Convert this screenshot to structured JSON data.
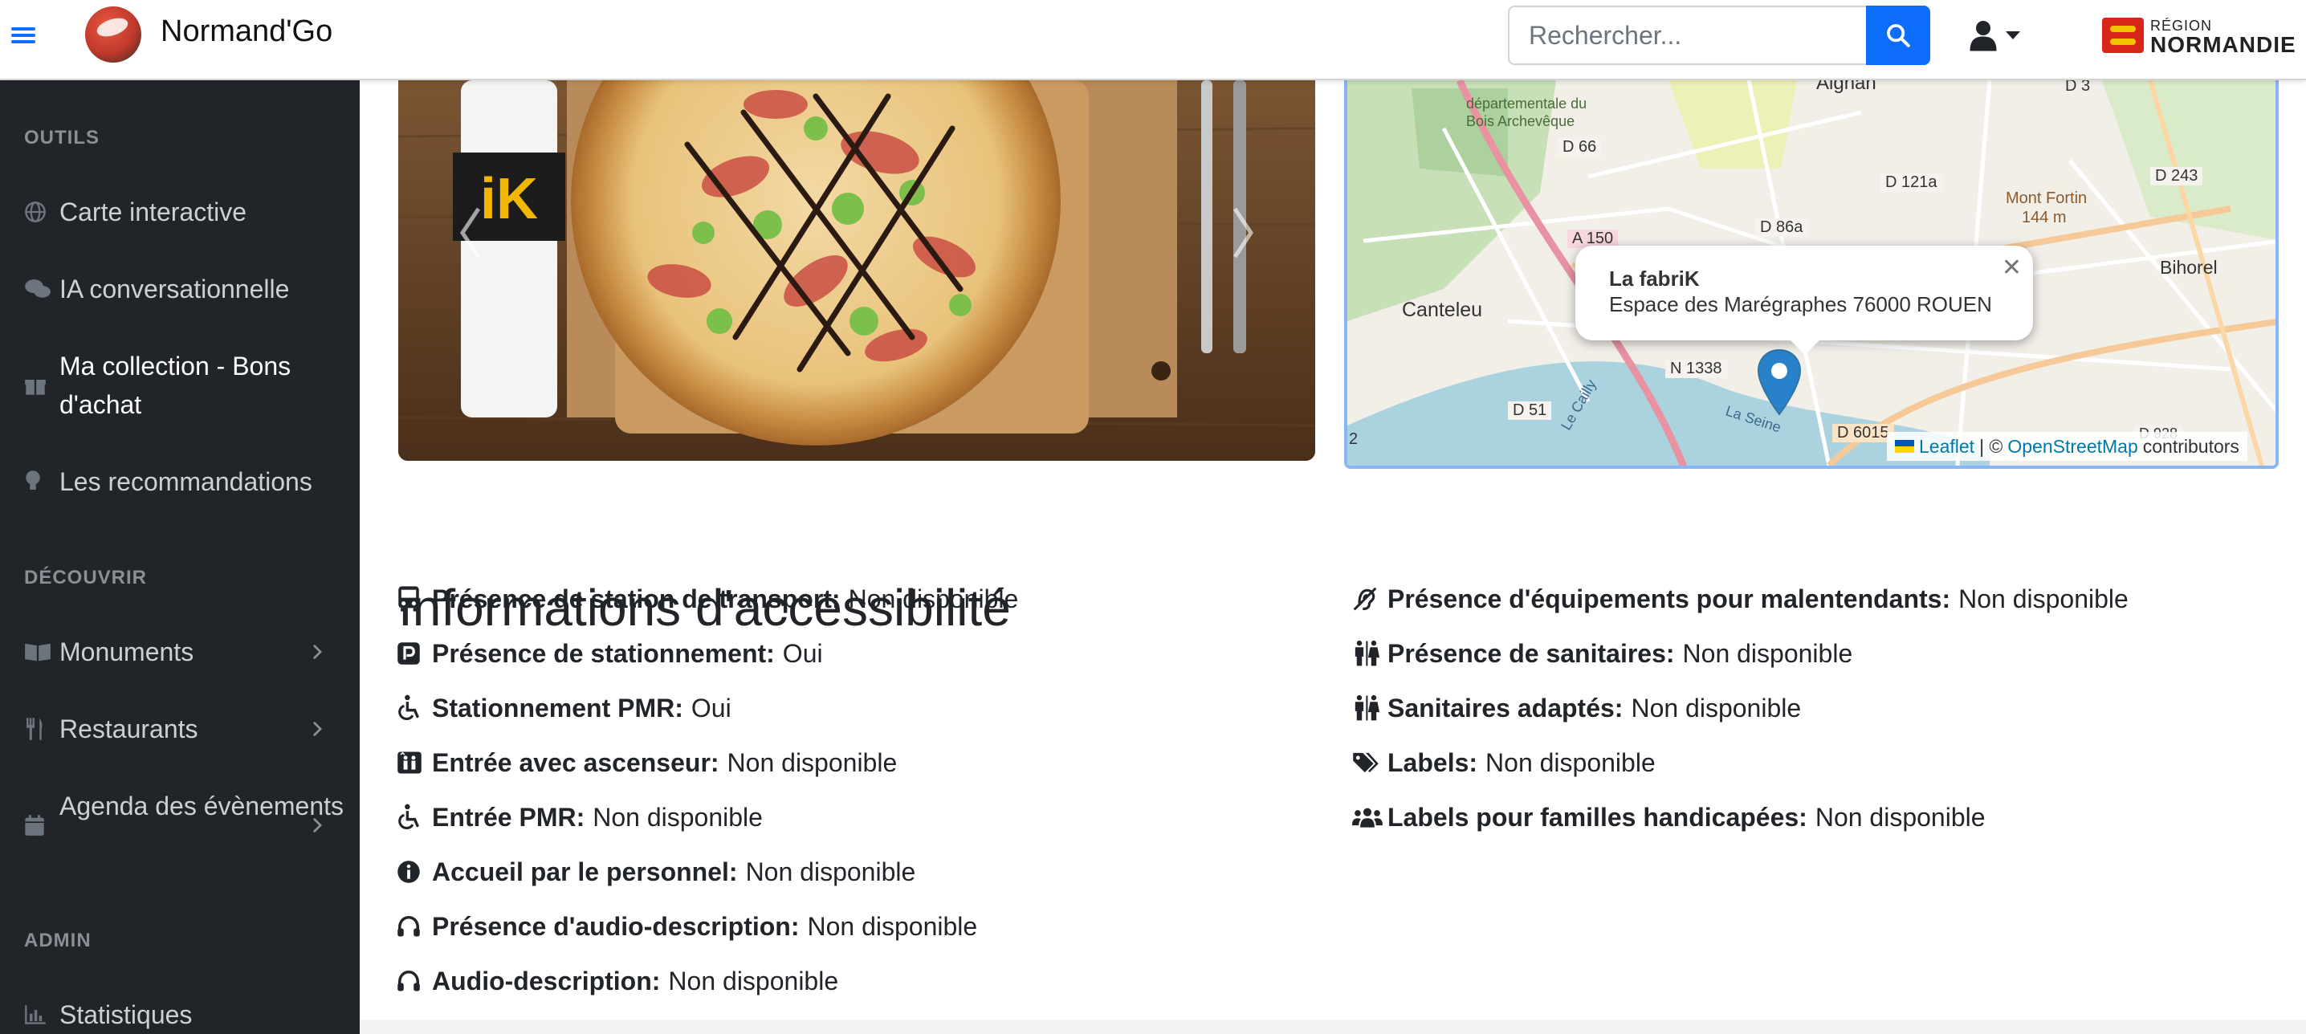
{
  "header": {
    "app_title": "Normand'Go",
    "search_placeholder": "Rechercher...",
    "region_small": "RÉGION",
    "region_big": "NORMANDIE"
  },
  "sidebar": {
    "sections": [
      {
        "heading": "OUTILS"
      },
      {
        "heading": "DÉCOUVRIR"
      },
      {
        "heading": "ADMIN"
      }
    ],
    "items": [
      {
        "label": "Carte interactive",
        "icon": "globe-icon"
      },
      {
        "label": "IA conversationnelle",
        "icon": "comments-icon"
      },
      {
        "label": "Ma collection - Bons d'achat",
        "icon": "gift-icon",
        "active": true
      },
      {
        "label": "Les recommandations",
        "icon": "lightbulb-icon"
      },
      {
        "label": "Monuments",
        "icon": "book-icon",
        "expandable": true
      },
      {
        "label": "Restaurants",
        "icon": "utensils-icon",
        "expandable": true
      },
      {
        "label": "Agenda des évènements",
        "icon": "calendar-icon",
        "expandable": true
      },
      {
        "label": "Statistiques",
        "icon": "chart-icon"
      }
    ]
  },
  "carousel": {
    "napkin_logo": "iK"
  },
  "map": {
    "popup_title": "La fabriK",
    "popup_address": "Espace des Marégraphes 76000 ROUEN",
    "labels": [
      "Canteleu",
      "Bihorel",
      "D 66",
      "A 150",
      "D 86a",
      "D 121a",
      "D 243",
      "N 1338",
      "D 51",
      "D 6015",
      "Mont Fortin",
      "144 m",
      "Aignan",
      "D 3",
      "2",
      "La Seine",
      "Le Cailly",
      "D 928"
    ],
    "forest_label": "départementale du Bois Archevêque",
    "attribution_leaflet": "Leaflet",
    "attribution_sep": "| ©",
    "attribution_osm": "OpenStreetMap",
    "attribution_tail": "contributors"
  },
  "accessibility": {
    "title": "Informations d'accessibilité",
    "left": [
      {
        "label": "Présence de station de transport:",
        "value": "Non disponible",
        "icon": "bus-icon"
      },
      {
        "label": "Présence de stationnement:",
        "value": "Oui",
        "icon": "parking-icon"
      },
      {
        "label": "Stationnement PMR:",
        "value": "Oui",
        "icon": "wheelchair-icon"
      },
      {
        "label": "Entrée avec ascenseur:",
        "value": "Non disponible",
        "icon": "elevator-icon"
      },
      {
        "label": "Entrée PMR:",
        "value": "Non disponible",
        "icon": "wheelchair-icon"
      },
      {
        "label": "Accueil par le personnel:",
        "value": "Non disponible",
        "icon": "info-icon"
      },
      {
        "label": "Présence d'audio-description:",
        "value": "Non disponible",
        "icon": "headphones-icon"
      },
      {
        "label": "Audio-description:",
        "value": "Non disponible",
        "icon": "headphones-icon"
      }
    ],
    "right": [
      {
        "label": "Présence d'équipements pour malentendants:",
        "value": "Non disponible",
        "icon": "deaf-icon"
      },
      {
        "label": "Présence de sanitaires:",
        "value": "Non disponible",
        "icon": "restroom-icon"
      },
      {
        "label": "Sanitaires adaptés:",
        "value": "Non disponible",
        "icon": "restroom-icon"
      },
      {
        "label": "Labels:",
        "value": "Non disponible",
        "icon": "tags-icon"
      },
      {
        "label": "Labels pour familles handicapées:",
        "value": "Non disponible",
        "icon": "users-icon"
      }
    ]
  },
  "colors": {
    "accent": "#0d6efd",
    "sidebar_bg": "#212529",
    "map_border": "#8ab4f8",
    "leaflet_link": "#0078a8"
  }
}
